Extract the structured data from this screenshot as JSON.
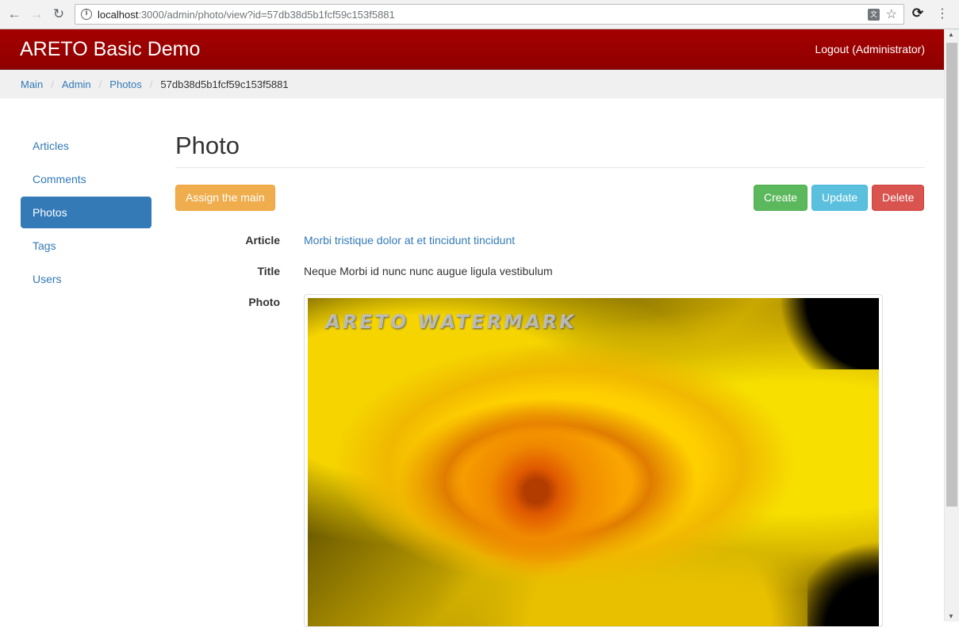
{
  "browser": {
    "url_host": "localhost",
    "url_rest": ":3000/admin/photo/view?id=57db38d5b1fcf59c153f5881"
  },
  "navbar": {
    "brand": "ARETO Basic Demo",
    "logout": "Logout (Administrator)"
  },
  "breadcrumb": {
    "items": [
      "Main",
      "Admin",
      "Photos"
    ],
    "active": "57db38d5b1fcf59c153f5881"
  },
  "sidebar": {
    "items": [
      {
        "label": "Articles"
      },
      {
        "label": "Comments"
      },
      {
        "label": "Photos"
      },
      {
        "label": "Tags"
      },
      {
        "label": "Users"
      }
    ]
  },
  "main": {
    "title": "Photo",
    "buttons": {
      "assign": "Assign the main",
      "create": "Create",
      "update": "Update",
      "delete": "Delete"
    },
    "fields": {
      "article_label": "Article",
      "article_value": "Morbi tristique dolor at et tincidunt tincidunt",
      "title_label": "Title",
      "title_value": "Neque Morbi id nunc nunc augue ligula vestibulum",
      "photo_label": "Photo",
      "watermark": "ARETO WATERMARK"
    }
  }
}
